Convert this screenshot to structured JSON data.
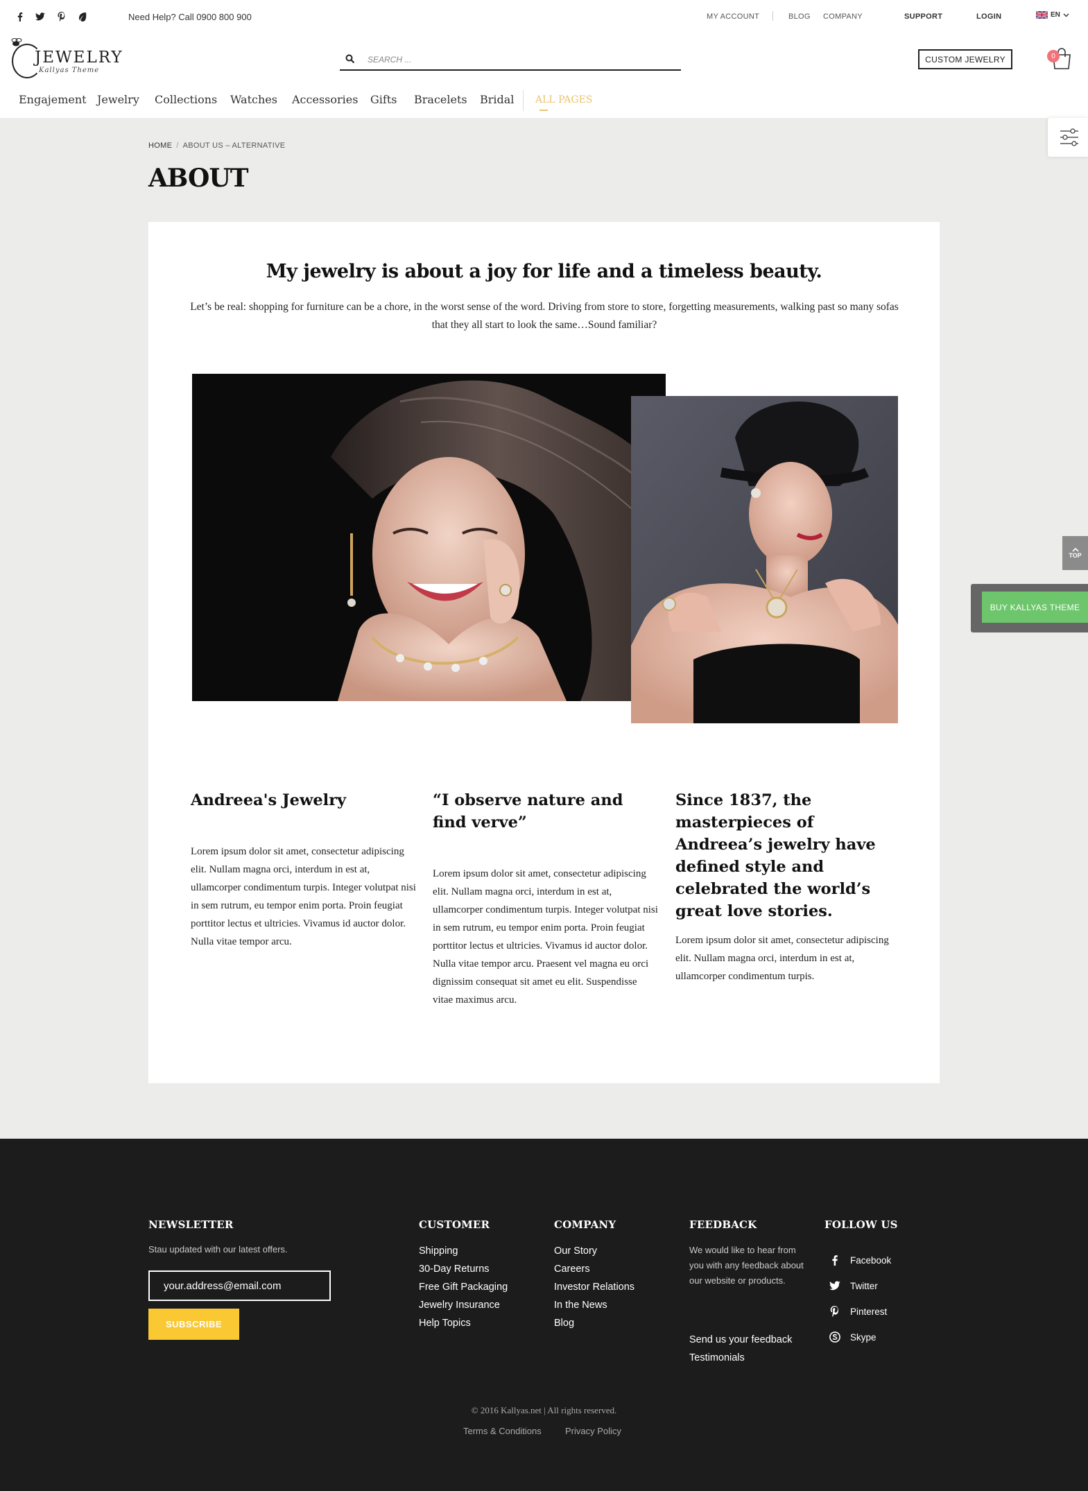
{
  "topbar": {
    "help": "Need Help? Call 0900 800 900",
    "links": {
      "my_account": "MY ACCOUNT",
      "blog": "BLOG",
      "company": "COMPANY",
      "support": "SUPPORT",
      "login": "LOGIN"
    },
    "language": "EN",
    "social_icons": [
      "facebook-icon",
      "twitter-icon",
      "pinterest-icon",
      "leaf-icon"
    ]
  },
  "header": {
    "logo_title": "JEWELRY",
    "logo_subtitle": "Kallyas Theme",
    "search_placeholder": "SEARCH ...",
    "custom_button": "CUSTOM JEWELRY",
    "cart_count": "0"
  },
  "nav": {
    "items": [
      "Engajement",
      "Jewelry",
      "Collections",
      "Watches",
      "Accessories",
      "Gifts",
      "Bracelets",
      "Bridal"
    ],
    "all_pages": "ALL PAGES"
  },
  "breadcrumb": {
    "home": "HOME",
    "current": "ABOUT US – ALTERNATIVE"
  },
  "page_title": "ABOUT",
  "side": {
    "top_label": "TOP",
    "buy_label": "BUY KALLYAS THEME"
  },
  "main": {
    "hero_title": "My jewelry is about a joy for life and a timeless beauty.",
    "hero_text": "Let’s be real: shopping for furniture can be a chore, in the worst sense of the word. Driving from store to store, forgetting measurements, walking past so many sofas that they all start to look the same…Sound familiar?",
    "columns": [
      {
        "heading": "Andreea's Jewelry",
        "text": "Lorem ipsum dolor sit amet, consectetur adipiscing elit. Nullam magna orci, interdum in est at, ullamcorper condimentum turpis. Integer volutpat nisi in sem rutrum, eu tempor enim porta. Proin feugiat porttitor lectus et ultricies. Vivamus id auctor dolor. Nulla vitae tempor arcu."
      },
      {
        "heading": "“I observe nature and find verve”",
        "text": "Lorem ipsum dolor sit amet, consectetur adipiscing elit. Nullam magna orci, interdum in est at, ullamcorper condimentum turpis. Integer volutpat nisi in sem rutrum, eu tempor enim porta. Proin feugiat porttitor lectus et ultricies. Vivamus id auctor dolor. Nulla vitae tempor arcu. Praesent vel magna eu orci dignissim consequat sit amet eu elit. Suspendisse vitae maximus arcu."
      },
      {
        "heading": "Since 1837, the masterpieces of Andreea’s jewelry have defined style and celebrated the world’s great love stories.",
        "text": "Lorem ipsum dolor sit amet, consectetur adipiscing elit. Nullam magna orci, interdum in est at, ullamcorper condimentum turpis."
      }
    ]
  },
  "footer": {
    "newsletter": {
      "title": "NEWSLETTER",
      "text": "Stau updated with our latest offers.",
      "input_value": "your.address@email.com",
      "button": "SUBSCRIBE"
    },
    "customer": {
      "title": "CUSTOMER",
      "links": [
        "Shipping",
        "30-Day Returns",
        "Free Gift Packaging",
        "Jewelry Insurance",
        "Help Topics"
      ]
    },
    "company": {
      "title": "COMPANY",
      "links": [
        "Our Story",
        "Careers",
        "Investor Relations",
        "In the News",
        "Blog"
      ]
    },
    "feedback": {
      "title": "FEEDBACK",
      "text": "We would like to hear from you with any feedback about our website or products.",
      "links": [
        "Send us your feedback",
        "Testimonials"
      ]
    },
    "follow": {
      "title": "FOLLOW US",
      "links": [
        "Facebook",
        "Twitter",
        "Pinterest",
        "Skype"
      ]
    },
    "copyright": "© 2016 Kallyas.net | All rights reserved.",
    "terms": "Terms & Conditions",
    "privacy": "Privacy Policy"
  },
  "colors": {
    "accent_gold": "#e9c46a",
    "subscribe_yellow": "#fac832",
    "buy_green": "#6dc66b",
    "cart_badge": "#f2727a",
    "footer_bg": "#1c1c1c",
    "page_bg": "#ecedea"
  }
}
